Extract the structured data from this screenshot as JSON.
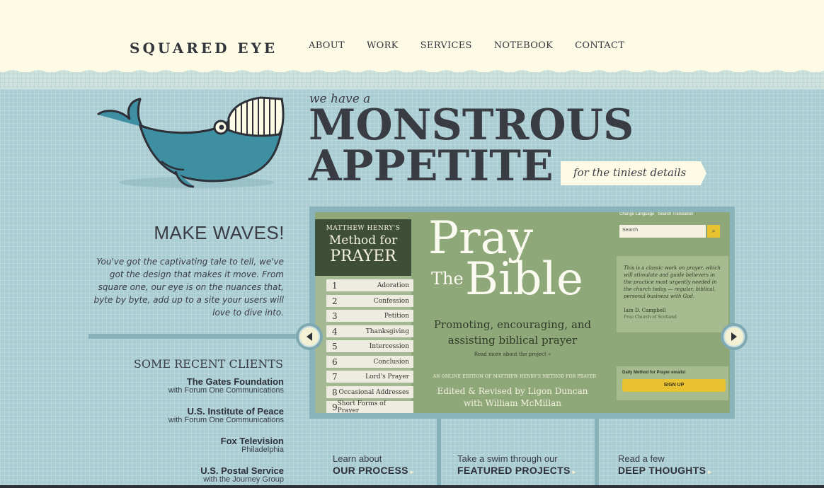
{
  "header": {
    "logo": "SQUARED EYE",
    "nav": [
      "ABOUT",
      "WORK",
      "SERVICES",
      "NOTEBOOK",
      "CONTACT"
    ]
  },
  "hero": {
    "sub": "we have a",
    "line1": "MONSTROUS",
    "line2": "APPETITE",
    "tagline": "for the tiniest details"
  },
  "waves": {
    "title": "MAKE WAVES!",
    "text": "You've got the captivating tale to tell, we've got the design that makes it move. From square one, our eye is on the nuances that, byte by byte, add up to a site your users will love to dive into."
  },
  "clients": {
    "title": "SOME RECENT CLIENTS",
    "items": [
      {
        "name": "The Gates Foundation",
        "sub": "with Forum One Communications"
      },
      {
        "name": "U.S. Institute of Peace",
        "sub": "with Forum One Communications"
      },
      {
        "name": "Fox Television",
        "sub": "Philadelphia"
      },
      {
        "name": "U.S. Postal Service",
        "sub": "with the Journey Group"
      }
    ]
  },
  "slide": {
    "head1": "MATTHEW HENRY'S",
    "head2": "Method for",
    "head3": "PRAYER",
    "toc": [
      {
        "n": "1",
        "label": "Adoration"
      },
      {
        "n": "2",
        "label": "Confession"
      },
      {
        "n": "3",
        "label": "Petition"
      },
      {
        "n": "4",
        "label": "Thanksgiving"
      },
      {
        "n": "5",
        "label": "Intercession"
      },
      {
        "n": "6",
        "label": "Conclusion"
      },
      {
        "n": "7",
        "label": "Lord's Prayer"
      },
      {
        "n": "8",
        "label": "Occasional Addresses"
      },
      {
        "n": "9",
        "label": "Short Forms of Prayer"
      }
    ],
    "pray": "Pray",
    "the": "The",
    "bible": "Bible",
    "promo": "Promoting, encouraging, and assisting biblical prayer",
    "readmore": "Read more about the project »",
    "edition": "AN ONLINE EDITION OF MATTHEW HENRY'S METHOD FOR PRAYER",
    "editors1": "Edited & Revised by Ligon Duncan",
    "editors2": "with William McMillan",
    "lang1": "Change Language",
    "lang2": "Search Translation",
    "search_placeholder": "Search",
    "quote": "This is a classic work on prayer, which will stimulate and guide believers in the practice most urgently needed in the church today — regular, biblical, personal business with God.",
    "quote_author": "Iain D. Campbell",
    "quote_church": "Free Church of Scotland",
    "email_label": "Daily Method for Prayer emails!",
    "signup": "SIGN UP"
  },
  "ctas": [
    {
      "small": "Learn about",
      "big": "OUR PROCESS"
    },
    {
      "small": "Take a swim through our",
      "big": "FEATURED PROJECTS"
    },
    {
      "small": "Read a few",
      "big": "DEEP THOUGHTS"
    }
  ],
  "colors": {
    "background": "#a9cdd3",
    "header": "#fdfbe6",
    "text": "#3a3c44",
    "whale": "#3f8fa3",
    "slide_green": "#8fa87a",
    "button_yellow": "#e8c230"
  }
}
